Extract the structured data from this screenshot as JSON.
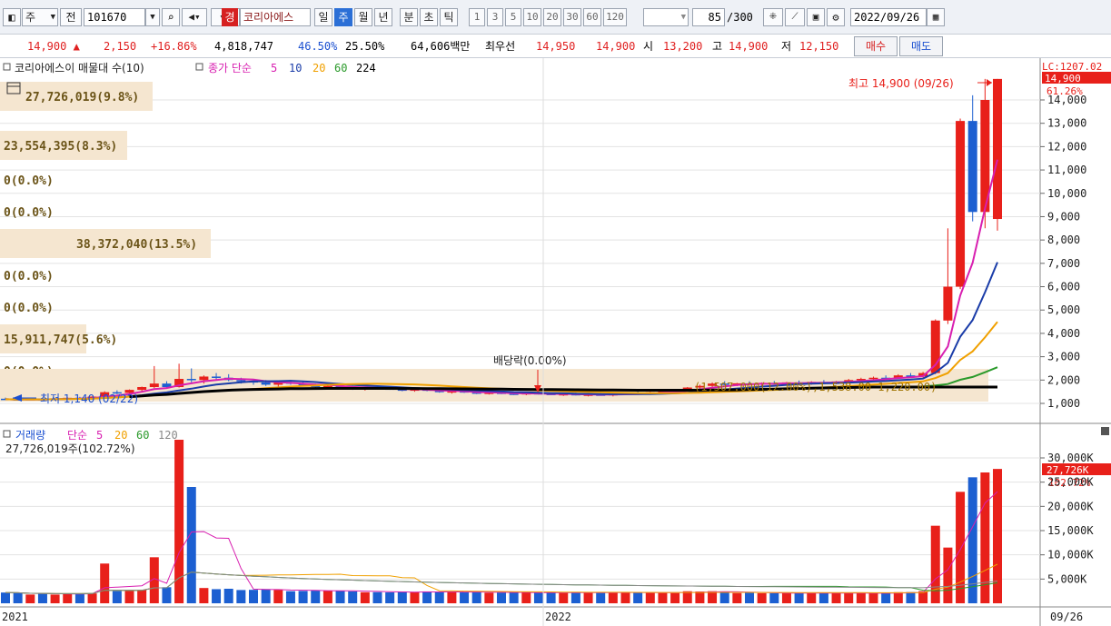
{
  "toolbar": {
    "period_select": "주",
    "prefix": "전",
    "code": "101670",
    "warning_badge": "경",
    "stock_name": "코리아에스",
    "periods": [
      "일",
      "주",
      "월",
      "년",
      "분",
      "초",
      "틱"
    ],
    "selected_period": "주",
    "intervals": [
      "1",
      "3",
      "5",
      "10",
      "20",
      "30",
      "60",
      "120"
    ],
    "count_value": "85",
    "count_total": "/300",
    "date": "2022/09/26"
  },
  "quote": {
    "price": "14,900",
    "change": "2,150",
    "change_pct": "+16.86%",
    "volume": "4,818,747",
    "ratio1": "46.50%",
    "ratio2": "25.50%",
    "amount": "64,606백만",
    "best_label": "최우선",
    "best_ask": "14,950",
    "best_bid": "14,900",
    "open_label": "시",
    "open": "13,200",
    "high_label": "고",
    "high": "14,900",
    "low_label": "저",
    "low": "12,150",
    "buy_button": "매수",
    "sell_button": "매도"
  },
  "price_panel": {
    "legend_title": "코리아에스이 매물대 수(10)",
    "ma_label": "종가 단순",
    "ma_periods": [
      "5",
      "10",
      "20",
      "60",
      "224"
    ],
    "ma_colors": [
      "#d81fb0",
      "#1a3ca8",
      "#f0a000",
      "#2a9a2a",
      "#000000"
    ],
    "volume_profile": [
      {
        "label": "27,726,019(9.8%)",
        "width": 168
      },
      {
        "label": "23,554,395(8.3%)",
        "width": 140
      },
      {
        "label": "0(0.0%)",
        "width": 0
      },
      {
        "label": "0(0.0%)",
        "width": 0
      },
      {
        "label": "38,372,040(13.5%)",
        "width": 232
      },
      {
        "label": "0(0.0%)",
        "width": 0
      },
      {
        "label": "0(0.0%)",
        "width": 0
      },
      {
        "label": "15,911,747(5.6%)",
        "width": 95
      },
      {
        "label": "0(0.0%)",
        "width": 0
      },
      {
        "label": "",
        "width": 1088
      }
    ],
    "high_annotation": "최고 14,900 (09/26)",
    "low_annotation": "최저 1,140 (02/22)",
    "dividend_annotation": "배당락(0.00%)",
    "overlay_text": "(1,507.000(12.00%),1,538.00 1,220.00)",
    "right_top_label": "LC:1207.02",
    "last_price_tag": "14,900",
    "last_pct_tag": "61.26%",
    "y_ticks": [
      "14,000",
      "13,000",
      "12,000",
      "11,000",
      "10,000",
      "9,000",
      "8,000",
      "7,000",
      "6,000",
      "5,000",
      "4,000",
      "3,000",
      "2,000",
      "1,000"
    ]
  },
  "volume_panel": {
    "legend_title": "거래량",
    "ma_label": "단순",
    "ma_periods": [
      "5",
      "20",
      "60",
      "120"
    ],
    "ma_colors": [
      "#d81fb0",
      "#f0a000",
      "#2a9a2a",
      "#888888"
    ],
    "current_volume": "27,726,019주(102.72%)",
    "last_tag": "27,726K",
    "last_pct_tag": "102.72%",
    "y_ticks": [
      "30,000K",
      "25,000K",
      "20,000K",
      "15,000K",
      "10,000K",
      "5,000K"
    ]
  },
  "x_axis": {
    "labels": [
      "2021",
      "2022"
    ],
    "last_date": "09/26"
  },
  "colors": {
    "up": "#e8201a",
    "down": "#1c5fd1",
    "profile": "#f5e6d0"
  },
  "chart_data": {
    "type": "candlestick",
    "price_min": 1000,
    "price_max": 14900,
    "candles": [
      [
        1200,
        1250,
        1150,
        1180
      ],
      [
        1180,
        1220,
        1130,
        1150
      ],
      [
        1150,
        1200,
        1140,
        1190
      ],
      [
        1190,
        1240,
        1160,
        1170
      ],
      [
        1170,
        1210,
        1150,
        1200
      ],
      [
        1200,
        1260,
        1180,
        1240
      ],
      [
        1240,
        1280,
        1200,
        1220
      ],
      [
        1220,
        1300,
        1210,
        1290
      ],
      [
        1290,
        1520,
        1280,
        1480
      ],
      [
        1480,
        1560,
        1400,
        1450
      ],
      [
        1450,
        1600,
        1420,
        1580
      ],
      [
        1580,
        1720,
        1500,
        1700
      ],
      [
        1700,
        2600,
        1650,
        1850
      ],
      [
        1850,
        1950,
        1650,
        1700
      ],
      [
        1700,
        2700,
        1680,
        2050
      ],
      [
        2050,
        2500,
        1900,
        2000
      ],
      [
        2000,
        2200,
        1850,
        2150
      ],
      [
        2150,
        2300,
        2000,
        2100
      ],
      [
        2100,
        2250,
        1950,
        2000
      ],
      [
        2000,
        2100,
        1850,
        1950
      ],
      [
        1950,
        2050,
        1800,
        1900
      ],
      [
        1900,
        2000,
        1750,
        1800
      ],
      [
        1800,
        1950,
        1700,
        1900
      ],
      [
        1900,
        2000,
        1800,
        1850
      ],
      [
        1850,
        1950,
        1750,
        1780
      ],
      [
        1780,
        1850,
        1650,
        1700
      ],
      [
        1700,
        1800,
        1600,
        1750
      ],
      [
        1750,
        1850,
        1650,
        1680
      ],
      [
        1680,
        1750,
        1580,
        1620
      ],
      [
        1620,
        1700,
        1550,
        1660
      ],
      [
        1660,
        1750,
        1600,
        1640
      ],
      [
        1640,
        1720,
        1580,
        1600
      ],
      [
        1600,
        1680,
        1520,
        1560
      ],
      [
        1560,
        1640,
        1500,
        1600
      ],
      [
        1600,
        1680,
        1520,
        1540
      ],
      [
        1540,
        1600,
        1460,
        1480
      ],
      [
        1480,
        1560,
        1420,
        1520
      ],
      [
        1520,
        1580,
        1450,
        1470
      ],
      [
        1470,
        1540,
        1400,
        1430
      ],
      [
        1430,
        1500,
        1380,
        1460
      ],
      [
        1460,
        1520,
        1400,
        1420
      ],
      [
        1420,
        1480,
        1360,
        1400
      ],
      [
        1400,
        1470,
        1350,
        1440
      ],
      [
        1440,
        1500,
        1380,
        1410
      ],
      [
        1410,
        1460,
        1350,
        1370
      ],
      [
        1370,
        1430,
        1320,
        1400
      ],
      [
        1400,
        1460,
        1340,
        1360
      ],
      [
        1360,
        1420,
        1300,
        1380
      ],
      [
        1380,
        1440,
        1330,
        1350
      ],
      [
        1350,
        1420,
        1300,
        1400
      ],
      [
        1400,
        1480,
        1350,
        1450
      ],
      [
        1450,
        1520,
        1400,
        1420
      ],
      [
        1420,
        1500,
        1380,
        1480
      ],
      [
        1480,
        1560,
        1440,
        1520
      ],
      [
        1520,
        1600,
        1480,
        1560
      ],
      [
        1560,
        1700,
        1520,
        1680
      ],
      [
        1680,
        1800,
        1620,
        1750
      ],
      [
        1750,
        1900,
        1700,
        1850
      ],
      [
        1850,
        1950,
        1780,
        1800
      ],
      [
        1800,
        1880,
        1740,
        1860
      ],
      [
        1860,
        1950,
        1800,
        1820
      ],
      [
        1820,
        1900,
        1760,
        1880
      ],
      [
        1880,
        1960,
        1820,
        1840
      ],
      [
        1840,
        1920,
        1780,
        1900
      ],
      [
        1900,
        1980,
        1840,
        1860
      ],
      [
        1860,
        1950,
        1800,
        1920
      ],
      [
        1920,
        2000,
        1860,
        1880
      ],
      [
        1880,
        1960,
        1820,
        1940
      ],
      [
        1940,
        2050,
        1900,
        2000
      ],
      [
        2000,
        2100,
        1950,
        2050
      ],
      [
        2050,
        2150,
        2000,
        2100
      ],
      [
        2100,
        2200,
        2050,
        2080
      ],
      [
        2080,
        2250,
        2050,
        2200
      ],
      [
        2200,
        2300,
        2100,
        2150
      ],
      [
        2150,
        2350,
        2100,
        2300
      ],
      [
        2300,
        4600,
        2250,
        4550
      ],
      [
        4550,
        8500,
        4400,
        6000
      ],
      [
        6000,
        13200,
        5900,
        13100
      ],
      [
        13100,
        14200,
        8800,
        9200
      ],
      [
        9200,
        14900,
        8500,
        14000
      ],
      [
        8900,
        14900,
        8400,
        14900
      ]
    ]
  }
}
